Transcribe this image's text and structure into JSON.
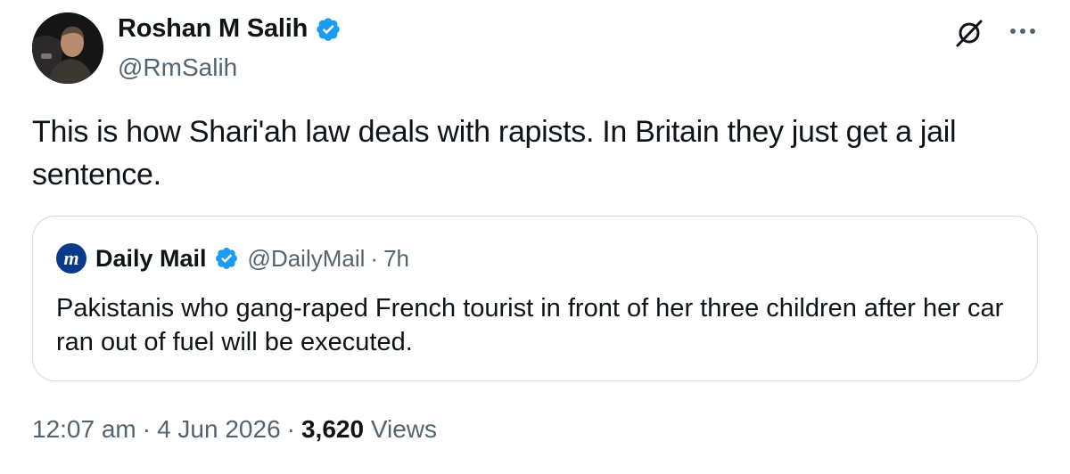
{
  "author": {
    "name": "Roshan M Salih",
    "handle": "@RmSalih",
    "verified_color": "#1d9bf0"
  },
  "tweet": {
    "text": "This is how Shari'ah law deals with rapists. In Britain they just get a jail sentence."
  },
  "quote": {
    "logo_letter": "m",
    "name": "Daily Mail",
    "handle": "@DailyMail",
    "dot": "·",
    "time": "7h",
    "text": "Pakistanis who gang-raped French tourist in front of her three children after her car ran out of fuel will be executed."
  },
  "meta": {
    "time": "12:07 am",
    "sep": "·",
    "date": "4 Jun 2026",
    "views_count": "3,620",
    "views_label": "Views"
  },
  "icons": {
    "grok": "grok-icon",
    "more": "more-options-icon",
    "verified": "verified-badge-icon"
  },
  "colors": {
    "text": "#0f1419",
    "muted": "#536471",
    "border": "#cfd9de",
    "daily_mail_logo": "#0a3a8c"
  }
}
